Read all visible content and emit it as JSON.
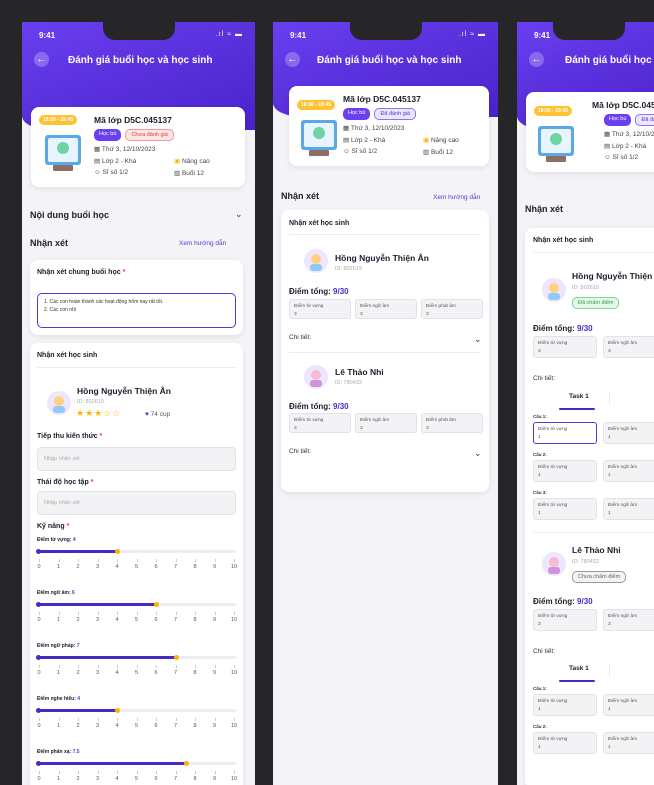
{
  "status": {
    "time": "9:41",
    "signal": ".ıl ≈ ▬"
  },
  "header": {
    "title": "Đánh giá buổi học và học sinh"
  },
  "class_card": {
    "time": "18:00 - 19:45",
    "code": "Mã lớp D5C.045137",
    "tag_type": "Học bù",
    "tag_not_rated": "Chưa đánh giá",
    "tag_rated": "Đã đánh giá",
    "date": "Thứ 3, 12/10/2023",
    "class_name": "Lớp 2 - Khá",
    "level": "Nâng cao",
    "size": "Sĩ số 1/2",
    "session": "Buổi 12"
  },
  "sections": {
    "content": "Nội dung buổi học",
    "comments": "Nhận xét",
    "guide": "Xem hướng dẫn",
    "general_comment": "Nhận xét chung buổi học",
    "general_text": "1. Các con hoàn thành các hoạt động hôm nay rất tốt.\n2. Các con nhì",
    "student_comments": "Nhận xét học sinh"
  },
  "form": {
    "absorb": "Tiếp thu kiến thức",
    "attitude": "Thái độ học tập",
    "placeholder": "Nhập nhận xét",
    "skills": "Kỹ năng",
    "required": "*"
  },
  "skill_sliders": [
    {
      "label": "Điểm từ vựng:",
      "value": 4
    },
    {
      "label": "Điểm ngữ âm:",
      "value": 6
    },
    {
      "label": "Điểm ngữ pháp:",
      "value": 7
    },
    {
      "label": "Điểm nghe hiểu:",
      "value": 4
    },
    {
      "label": "Điểm phản xạ:",
      "value": 7.5
    }
  ],
  "slider_scale": [
    "0",
    "1",
    "2",
    "3",
    "4",
    "5",
    "6",
    "7",
    "8",
    "9",
    "10"
  ],
  "students": [
    {
      "name": "Hồng Nguyễn Thiện Ân",
      "id": "ID: 802619",
      "stars": 3,
      "cup": "74 cup",
      "status": "Đã chấm điểm"
    },
    {
      "name": "Lê Thảo Nhi",
      "id": "ID: 780432",
      "status": "Chưa chấm điểm"
    }
  ],
  "scoring": {
    "total_label": "Điểm tổng:",
    "total_value": "9/30",
    "vocab": "Điểm từ vựng",
    "phonetic": "Điểm ngữ âm",
    "pronun": "Điểm phát âm",
    "detail": "Chi tiết:",
    "task": "Task 1",
    "q1": "Câu 1:",
    "q2": "Câu 2:",
    "q3": "Câu 3:",
    "v3": "3",
    "v1": "1"
  },
  "colors": {
    "primary": "#5a35d6",
    "accent": "#ffb300",
    "danger": "#e53935",
    "success": "#2e9c50"
  }
}
